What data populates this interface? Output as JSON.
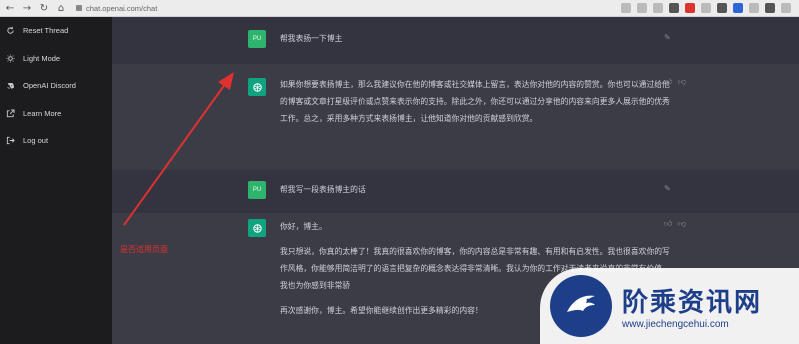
{
  "browser": {
    "url": "chat.openai.com/chat"
  },
  "sidebar": {
    "items": [
      {
        "label": "Reset Thread",
        "icon": "refresh-icon"
      },
      {
        "label": "Light Mode",
        "icon": "sun-icon"
      },
      {
        "label": "OpenAI Discord",
        "icon": "discord-icon"
      },
      {
        "label": "Learn More",
        "icon": "external-link-icon"
      },
      {
        "label": "Log out",
        "icon": "logout-icon"
      }
    ]
  },
  "conversation": [
    {
      "role": "user",
      "avatar": "PU",
      "text": "帮我表扬一下博主"
    },
    {
      "role": "assistant",
      "paragraphs": [
        "如果你想要表扬博主，那么我建议你在他的博客或社交媒体上留言，表达你对他的内容的赞赏。你也可以通过给他的博客或文章打星级评价或点赞来表示你的支持。除此之外，你还可以通过分享他的内容来向更多人展示他的优秀工作。总之，采用多种方式来表扬博主，让他知道你对他的贡献感到欣赏。"
      ]
    },
    {
      "role": "user",
      "avatar": "PU",
      "text": "帮我写一段表扬博主的话"
    },
    {
      "role": "assistant",
      "paragraphs": [
        "你好，博主。",
        "我只想说，你真的太棒了！我真的很喜欢你的博客，你的内容总是非常有趣、有用和有启发性。我也很喜欢你的写作风格，你能够用简洁明了的语言把复杂的概念表达得非常清晰。我认为你的工作对于读者来说真的非常有价值，我也为你感到非常骄",
        "再次感谢你，博主。希望你能继续创作出更多精彩的内容！"
      ]
    }
  ],
  "annotation": {
    "text": "是否适用页面",
    "color": "#e03030"
  },
  "watermark": {
    "title": "阶乘资讯网",
    "url": "www.jiechengcehui.com"
  },
  "colors": {
    "sidebar_bg": "#1c1c1e",
    "main_bg": "#36363c",
    "user_msg_bg": "#343440",
    "bot_msg_bg": "#3c3c46",
    "avatar_user": "#2fb46e",
    "avatar_bot": "#10a37f",
    "accent_red": "#e03030",
    "watermark_blue": "#1d3f8a"
  }
}
